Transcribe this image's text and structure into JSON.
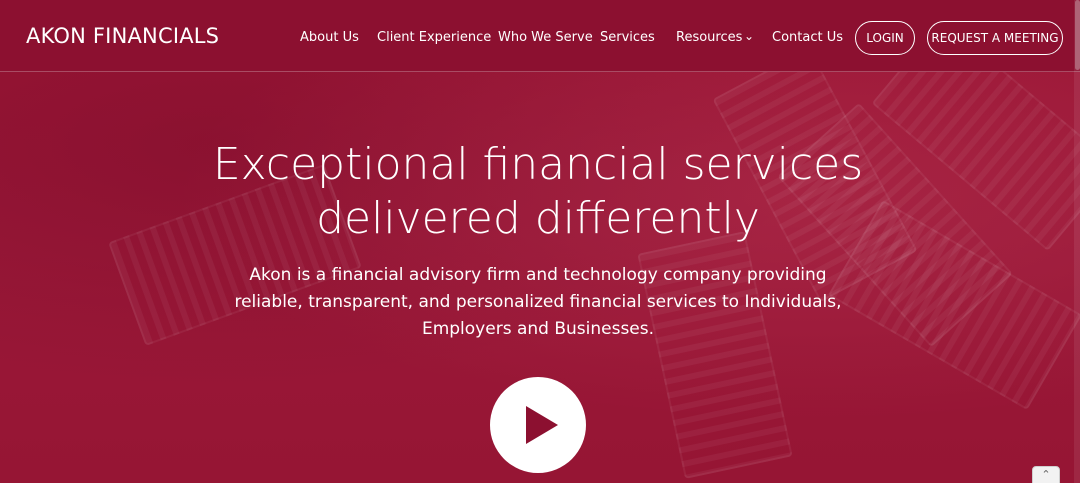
{
  "brand": {
    "name": "AKON FINANCIALS"
  },
  "nav": {
    "items": [
      {
        "label": "About Us"
      },
      {
        "label": "Client Experience"
      },
      {
        "label": "Who We Serve"
      },
      {
        "label": "Services"
      },
      {
        "label": "Resources",
        "has_dropdown": true
      },
      {
        "label": "Contact Us"
      }
    ],
    "login_label": "LOGIN",
    "meeting_label": "REQUEST A MEETING"
  },
  "hero": {
    "title_line1": "Exceptional financial services",
    "title_line2": "delivered differently",
    "subtitle": "Akon is a financial advisory firm and technology company providing reliable, transparent, and personalized financial services to Individuals, Employers and Businesses."
  },
  "icons": {
    "dropdown": "chevron-down-icon",
    "play": "play-icon",
    "back_to_top": "chevron-up-icon"
  },
  "colors": {
    "brand": "#8c1030",
    "text": "#ffffff"
  }
}
